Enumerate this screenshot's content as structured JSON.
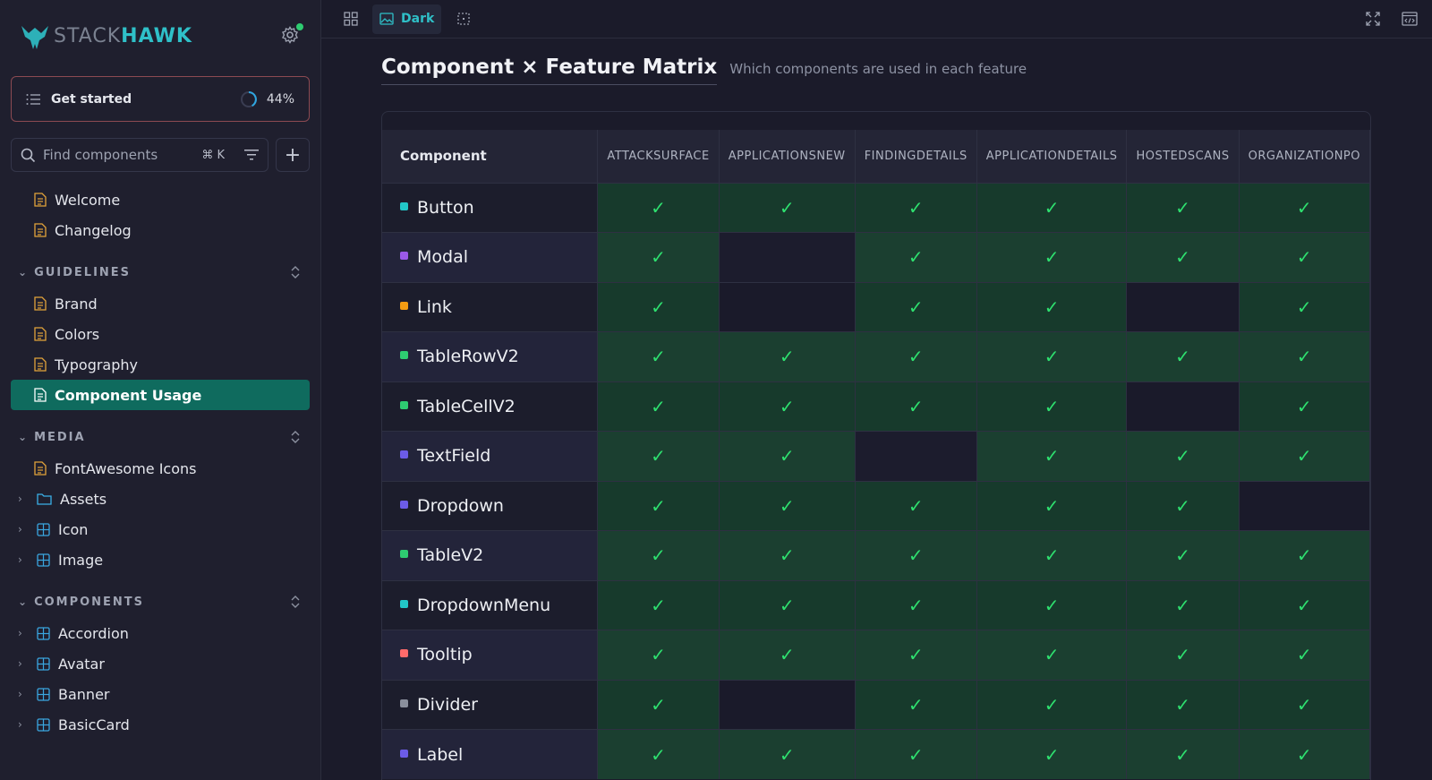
{
  "brand": {
    "stack": "STACK",
    "hawk": "HAWK"
  },
  "sidebar": {
    "get_started": {
      "label": "Get started",
      "progress": "44%"
    },
    "search": {
      "placeholder": "Find components",
      "shortcut": "⌘ K"
    },
    "top_items": [
      "Welcome",
      "Changelog"
    ],
    "sections": [
      {
        "title": "GUIDELINES",
        "items": [
          {
            "label": "Brand",
            "type": "doc"
          },
          {
            "label": "Colors",
            "type": "doc"
          },
          {
            "label": "Typography",
            "type": "doc"
          },
          {
            "label": "Component Usage",
            "type": "doc",
            "active": true
          }
        ]
      },
      {
        "title": "MEDIA",
        "items": [
          {
            "label": "FontAwesome Icons",
            "type": "doc"
          },
          {
            "label": "Assets",
            "type": "folder"
          },
          {
            "label": "Icon",
            "type": "component"
          },
          {
            "label": "Image",
            "type": "component"
          }
        ]
      },
      {
        "title": "COMPONENTS",
        "items": [
          {
            "label": "Accordion",
            "type": "component"
          },
          {
            "label": "Avatar",
            "type": "component"
          },
          {
            "label": "Banner",
            "type": "component"
          },
          {
            "label": "BasicCard",
            "type": "component"
          }
        ]
      }
    ]
  },
  "toolbar": {
    "theme_label": "Dark"
  },
  "page": {
    "title": "Component × Feature Matrix",
    "subtitle": "Which components are used in each feature"
  },
  "matrix": {
    "first_col": "Component",
    "columns": [
      "ATTACKSURFACE",
      "APPLICATIONSNEW",
      "FINDINGDETAILS",
      "APPLICATIONDETAILS",
      "HOSTEDSCANS",
      "ORGANIZATIONPO"
    ],
    "check": "✓",
    "rows": [
      {
        "name": "Button",
        "color": "#22c7c7",
        "cells": [
          1,
          1,
          1,
          1,
          1,
          1
        ]
      },
      {
        "name": "Modal",
        "color": "#9b59e8",
        "cells": [
          1,
          0,
          1,
          1,
          1,
          1
        ]
      },
      {
        "name": "Link",
        "color": "#f39c12",
        "cells": [
          1,
          0,
          1,
          1,
          0,
          1
        ]
      },
      {
        "name": "TableRowV2",
        "color": "#2ecc71",
        "cells": [
          1,
          1,
          1,
          1,
          1,
          1
        ]
      },
      {
        "name": "TableCellV2",
        "color": "#2ecc71",
        "cells": [
          1,
          1,
          1,
          1,
          0,
          1
        ]
      },
      {
        "name": "TextField",
        "color": "#6c5ce7",
        "cells": [
          1,
          1,
          0,
          1,
          1,
          1
        ]
      },
      {
        "name": "Dropdown",
        "color": "#6c5ce7",
        "cells": [
          1,
          1,
          1,
          1,
          1,
          0
        ]
      },
      {
        "name": "TableV2",
        "color": "#2ecc71",
        "cells": [
          1,
          1,
          1,
          1,
          1,
          1
        ]
      },
      {
        "name": "DropdownMenu",
        "color": "#22c7c7",
        "cells": [
          1,
          1,
          1,
          1,
          1,
          1
        ]
      },
      {
        "name": "Tooltip",
        "color": "#ff6b6b",
        "cells": [
          1,
          1,
          1,
          1,
          1,
          1
        ]
      },
      {
        "name": "Divider",
        "color": "#8a8f9c",
        "cells": [
          1,
          0,
          1,
          1,
          1,
          1
        ]
      },
      {
        "name": "Label",
        "color": "#6c5ce7",
        "cells": [
          1,
          1,
          1,
          1,
          1,
          1
        ]
      }
    ]
  }
}
